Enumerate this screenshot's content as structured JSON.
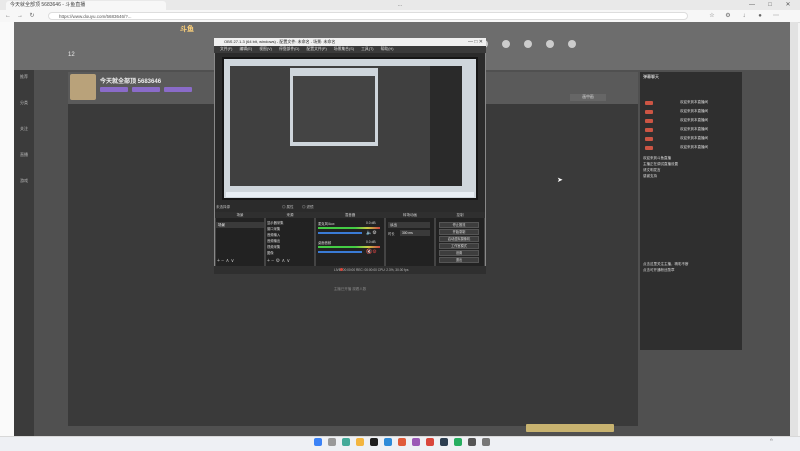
{
  "browser": {
    "tab_title": "今天就全部顶 5683646 - 斗鱼直播",
    "window_title": "...",
    "address": "https://www.douyu.com/5683646/?...",
    "win_controls": [
      "—",
      "□",
      "✕"
    ]
  },
  "room": {
    "streamer_name": "今天就全部顶 5683646",
    "follow_count": "12",
    "pip_label": "画中画",
    "footer_note": "主播已开播  观看人数"
  },
  "nav_items": [
    "",
    "",
    "",
    "",
    "",
    "",
    "",
    "",
    "",
    "",
    "",
    "",
    "",
    "",
    "",
    ""
  ],
  "sidebar": [
    "推荐",
    "分类",
    "关注",
    "直播",
    "游戏"
  ],
  "chat": {
    "header": "弹幕聊天",
    "messages": [
      "欢迎来到本直播间",
      "欢迎来到本直播间",
      "欢迎来到本直播间",
      "欢迎来到本直播间",
      "欢迎来到本直播间",
      "欢迎来到本直播间"
    ],
    "notice": [
      "欢迎来到斗鱼直播",
      "主播正在调试直播设置",
      "请文明发言",
      "感谢支持"
    ],
    "notice2": [
      "点击这里关注主播，精彩不断",
      "点击可开通粉丝勋章"
    ]
  },
  "obs": {
    "title": "OBS 27.1.3 (64 bit, windows) - 配置文件: 未命名 - 场景: 未命名",
    "menu": [
      "文件(F)",
      "编辑(E)",
      "视图(V)",
      "停靠部件(D)",
      "配置文件(P)",
      "场景集合(S)",
      "工具(T)",
      "帮助(H)"
    ],
    "no_source": "未选择源",
    "docks": [
      "场景",
      "来源",
      "混音器",
      "转场动画",
      "控制"
    ],
    "scene_item": "场景",
    "sources": [
      "显示器采集",
      "窗口采集",
      "音频输入",
      "音频输出",
      "视频采集",
      "图像"
    ],
    "mixer": [
      {
        "name": "麦克风/Aux",
        "db": "0.0 dB"
      },
      {
        "name": "桌面音频",
        "db": "0.0 dB"
      }
    ],
    "transition": "淡出",
    "duration_label": "时长",
    "duration": "300 ms",
    "controls": [
      "停止推流",
      "开始录制",
      "启动虚拟摄像机",
      "工作室模式",
      "设置",
      "退出"
    ],
    "status": "LIVE: 00:00:00   REC: 00:00:00   CPU: 2.3%, 30.00 fps"
  },
  "colors": {
    "accent": "#ff7700",
    "obs_bg": "#2b2b2b",
    "live_red": "#d9463b"
  }
}
